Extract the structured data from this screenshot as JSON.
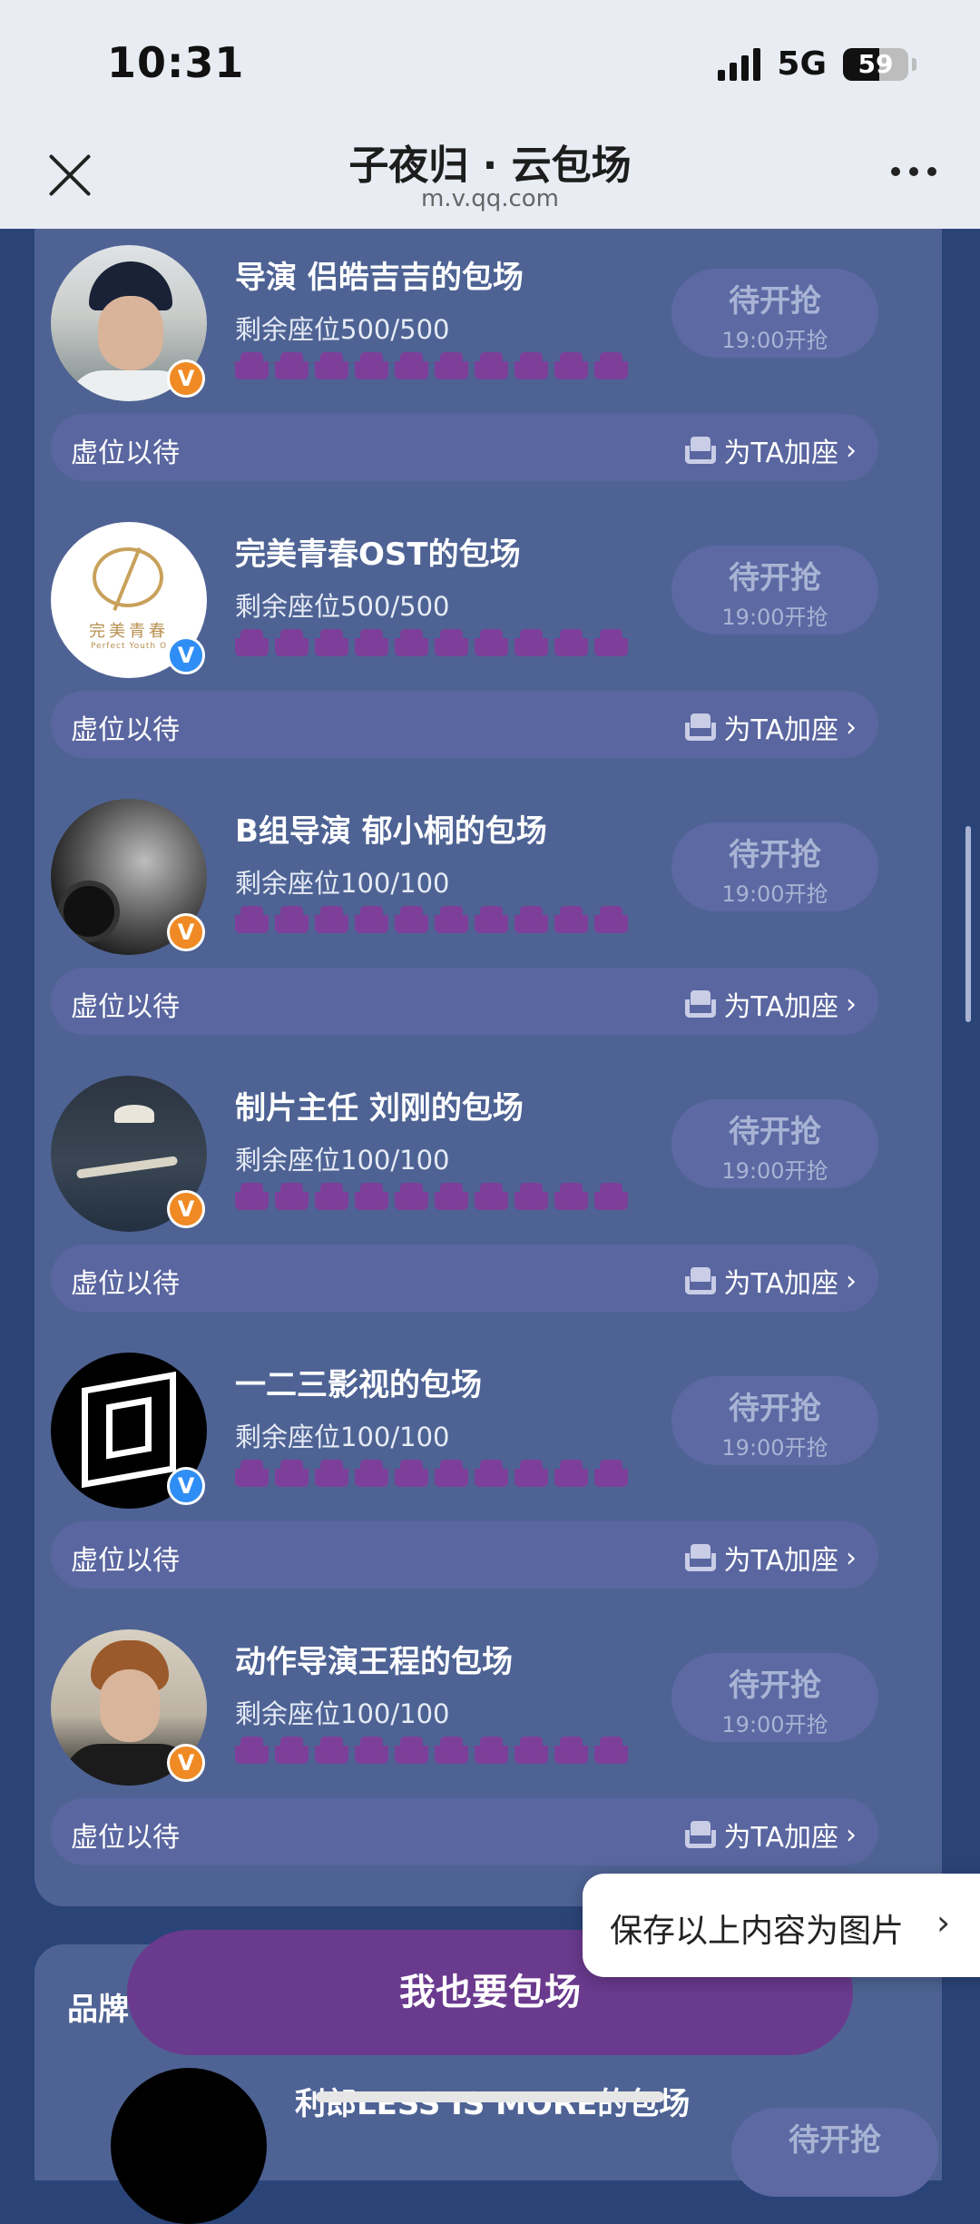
{
  "status_bar": {
    "time": "10:31",
    "network": "5G",
    "battery": "59"
  },
  "nav": {
    "title": "子夜归 · 云包场",
    "subtitle": "m.v.qq.com"
  },
  "entries": [
    {
      "title": "导演 侣皓吉吉的包场",
      "seats": "剩余座位500/500",
      "badge": "orange",
      "button_main": "待开抢",
      "button_time": "19:00开抢",
      "queue_text": "虚位以待",
      "add_seat": "为TA加座"
    },
    {
      "title": "完美青春OST的包场",
      "seats": "剩余座位500/500",
      "badge": "blue",
      "avatar_text": "完美青春",
      "avatar_subtext": "Perfect Youth O",
      "button_main": "待开抢",
      "button_time": "19:00开抢",
      "queue_text": "虚位以待",
      "add_seat": "为TA加座"
    },
    {
      "title": "B组导演 郁小桐的包场",
      "seats": "剩余座位100/100",
      "badge": "orange",
      "button_main": "待开抢",
      "button_time": "19:00开抢",
      "queue_text": "虚位以待",
      "add_seat": "为TA加座"
    },
    {
      "title": "制片主任 刘刚的包场",
      "seats": "剩余座位100/100",
      "badge": "orange",
      "button_main": "待开抢",
      "button_time": "19:00开抢",
      "queue_text": "虚位以待",
      "add_seat": "为TA加座"
    },
    {
      "title": "一二三影视的包场",
      "seats": "剩余座位100/100",
      "badge": "blue",
      "button_main": "待开抢",
      "button_time": "19:00开抢",
      "queue_text": "虚位以待",
      "add_seat": "为TA加座"
    },
    {
      "title": "动作导演王程的包场",
      "seats": "剩余座位100/100",
      "badge": "orange",
      "button_main": "待开抢",
      "button_time": "19:00开抢",
      "queue_text": "虚位以待",
      "add_seat": "为TA加座"
    }
  ],
  "next_section": {
    "label": "品牌",
    "entry_title": "利郎LESS IS MORE的包场",
    "button_main": "待开抢"
  },
  "save_toast": "保存以上内容为图片",
  "cta": "我也要包场",
  "colors": {
    "background": "#2b4478",
    "card": "#4e6394",
    "cta": "#6a3a8e",
    "seat": "#7d3f9a"
  }
}
